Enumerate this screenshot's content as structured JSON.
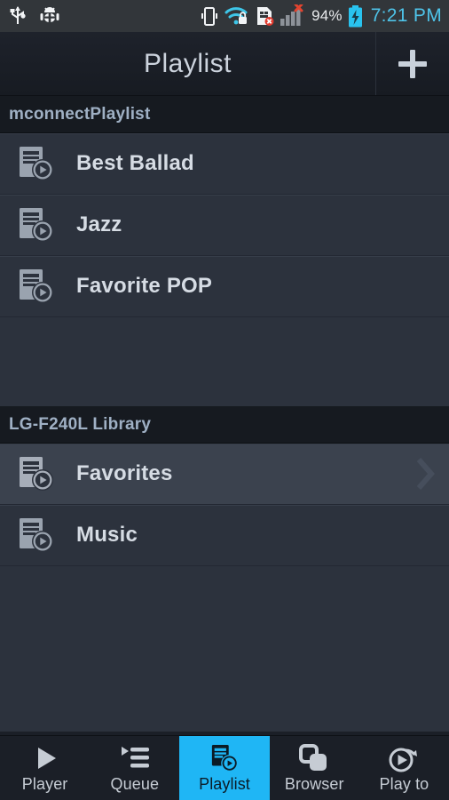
{
  "statusbar": {
    "icons_left": [
      "usb-icon",
      "android-debug-icon"
    ],
    "icons_right": [
      "vibrate-icon",
      "wifi-lock-icon",
      "sim-error-icon",
      "signal-bars-icon"
    ],
    "battery_percent": "94%",
    "battery_icon": "battery-charging-icon",
    "time": "7:21 PM",
    "time_color": "#4ec3e8",
    "battery_color": "#29c3ef"
  },
  "titlebar": {
    "title": "Playlist",
    "add_label": "+",
    "add_icon": "plus-icon"
  },
  "sections": [
    {
      "header": "mconnectPlaylist",
      "rows": [
        {
          "label": "Best Ballad",
          "icon": "playlist-icon",
          "selected": false,
          "chevron": false
        },
        {
          "label": "Jazz",
          "icon": "playlist-icon",
          "selected": false,
          "chevron": false
        },
        {
          "label": "Favorite POP",
          "icon": "playlist-icon",
          "selected": false,
          "chevron": false
        }
      ]
    },
    {
      "header": "LG-F240L Library",
      "rows": [
        {
          "label": "Favorites",
          "icon": "playlist-icon",
          "selected": true,
          "chevron": true
        },
        {
          "label": "Music",
          "icon": "playlist-icon",
          "selected": false,
          "chevron": false
        }
      ]
    }
  ],
  "navbar": {
    "accent_color": "#1fb6f5",
    "items": [
      {
        "label": "Player",
        "icon": "play-triangle-icon",
        "active": false
      },
      {
        "label": "Queue",
        "icon": "queue-list-icon",
        "active": false
      },
      {
        "label": "Playlist",
        "icon": "playlist-icon",
        "active": true
      },
      {
        "label": "Browser",
        "icon": "stacked-squares-icon",
        "active": false
      },
      {
        "label": "Play to",
        "icon": "play-to-icon",
        "active": false
      }
    ]
  }
}
